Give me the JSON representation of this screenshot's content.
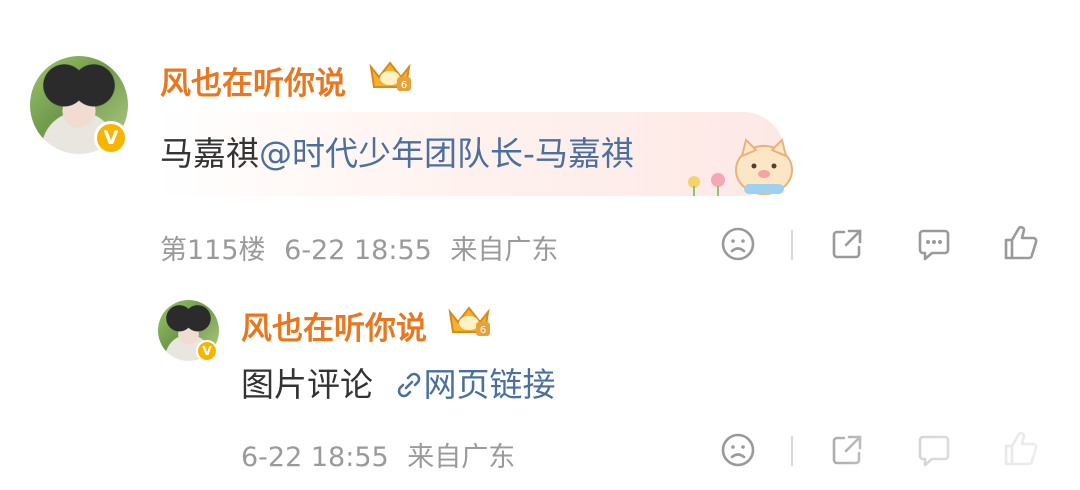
{
  "comment": {
    "username": "风也在听你说",
    "text_plain": "马嘉祺",
    "text_mention": "@时代少年团队长-马嘉祺",
    "floor": "第115楼",
    "time": "6-22 18:55",
    "source": "来自广东"
  },
  "reply": {
    "username": "风也在听你说",
    "text": "图片评论",
    "link_text": "网页链接",
    "time": "6-22 18:55",
    "source": "来自广东"
  },
  "colors": {
    "username": "#e8771f",
    "mention": "#4b6f9e",
    "meta": "#9a9a9a",
    "verified": "#f7b500"
  },
  "icons": {
    "dislike": "frown-face-icon",
    "share": "share-icon",
    "comment": "comment-icon",
    "like": "thumbs-up-icon",
    "link": "link-icon",
    "badge": "crown-fan-badge-icon",
    "verified": "verified-v-icon"
  }
}
